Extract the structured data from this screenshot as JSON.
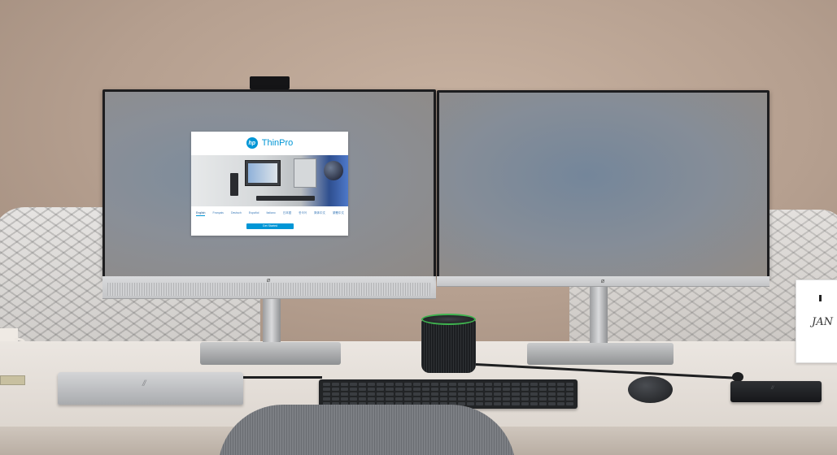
{
  "scene": {
    "description_kind": "photograph",
    "left_monitor_window": {
      "brand": "hp",
      "title": "ThinPro",
      "languages": [
        "English",
        "Français",
        "Deutsch",
        "Español",
        "Italiano",
        "日本語",
        "한국어",
        "简体中文",
        "繁體中文"
      ],
      "active_language": "English",
      "start_button": "Get Started"
    },
    "picture_frame_text": "JAN",
    "colors": {
      "wall": "#b59f8f",
      "desk": "#e7e1db",
      "hp_blue": "#0096d6",
      "speaker_ring": "#3fb34f"
    }
  }
}
